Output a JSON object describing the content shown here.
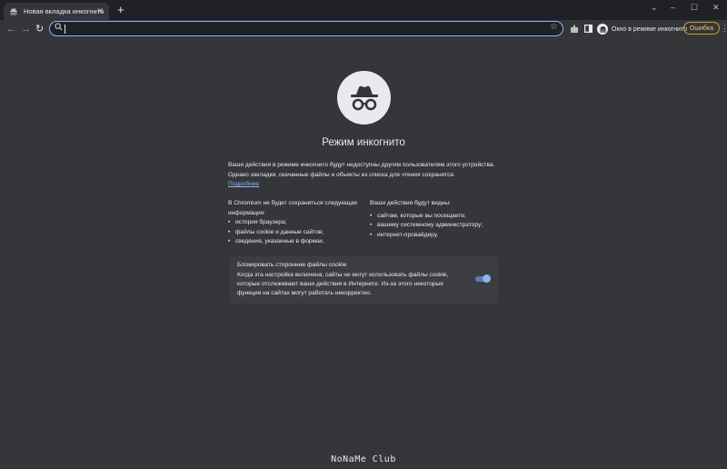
{
  "tab": {
    "title": "Новая вкладка инкогнито",
    "close": "✕"
  },
  "new_tab": "+",
  "window": {
    "chevron": "⌄",
    "minimize": "–",
    "maximize": "☐",
    "close": "✕"
  },
  "nav": {
    "back": "←",
    "forward": "→",
    "reload": "↻"
  },
  "omnibox": {
    "value": "",
    "placeholder": "",
    "star": "☆"
  },
  "toolbar": {
    "incognito_label": "Окно в режиме инкогнито",
    "error_label": "Ошибка",
    "menu": "⋮"
  },
  "page": {
    "heading": "Режим инкогнито",
    "intro": "Ваши действия в режиме инкогнито будут недоступны другим пользователям этого устройства. Однако закладки, скачанные файлы и объекты из списка для чтения сохранятся.",
    "learn_more": "Подробнее",
    "not_saved": {
      "title": "В Chromium не будет сохраняться следующая информация:",
      "items": [
        "история браузера;",
        "файлы cookie и данные сайтов;",
        "сведения, указанные в формах."
      ]
    },
    "visible_to": {
      "title": "Ваши действия будут видны:",
      "items": [
        "сайтам, которые вы посещаете;",
        "вашему системному администратору;",
        "интернет-провайдеру."
      ]
    },
    "cookie_card": {
      "title": "Блокировать сторонние файлы cookie",
      "description": "Когда эта настройка включена, сайты не могут использовать файлы cookie, которые отслеживают ваши действия в Интернете. Из-за этого некоторые функции на сайтах могут работать некорректно.",
      "enabled": true
    }
  },
  "watermark": "NoNaMe Club",
  "colors": {
    "background": "#35363a",
    "tabstrip": "#202124",
    "accent": "#8ab4f8",
    "error": "#e8c76b"
  }
}
